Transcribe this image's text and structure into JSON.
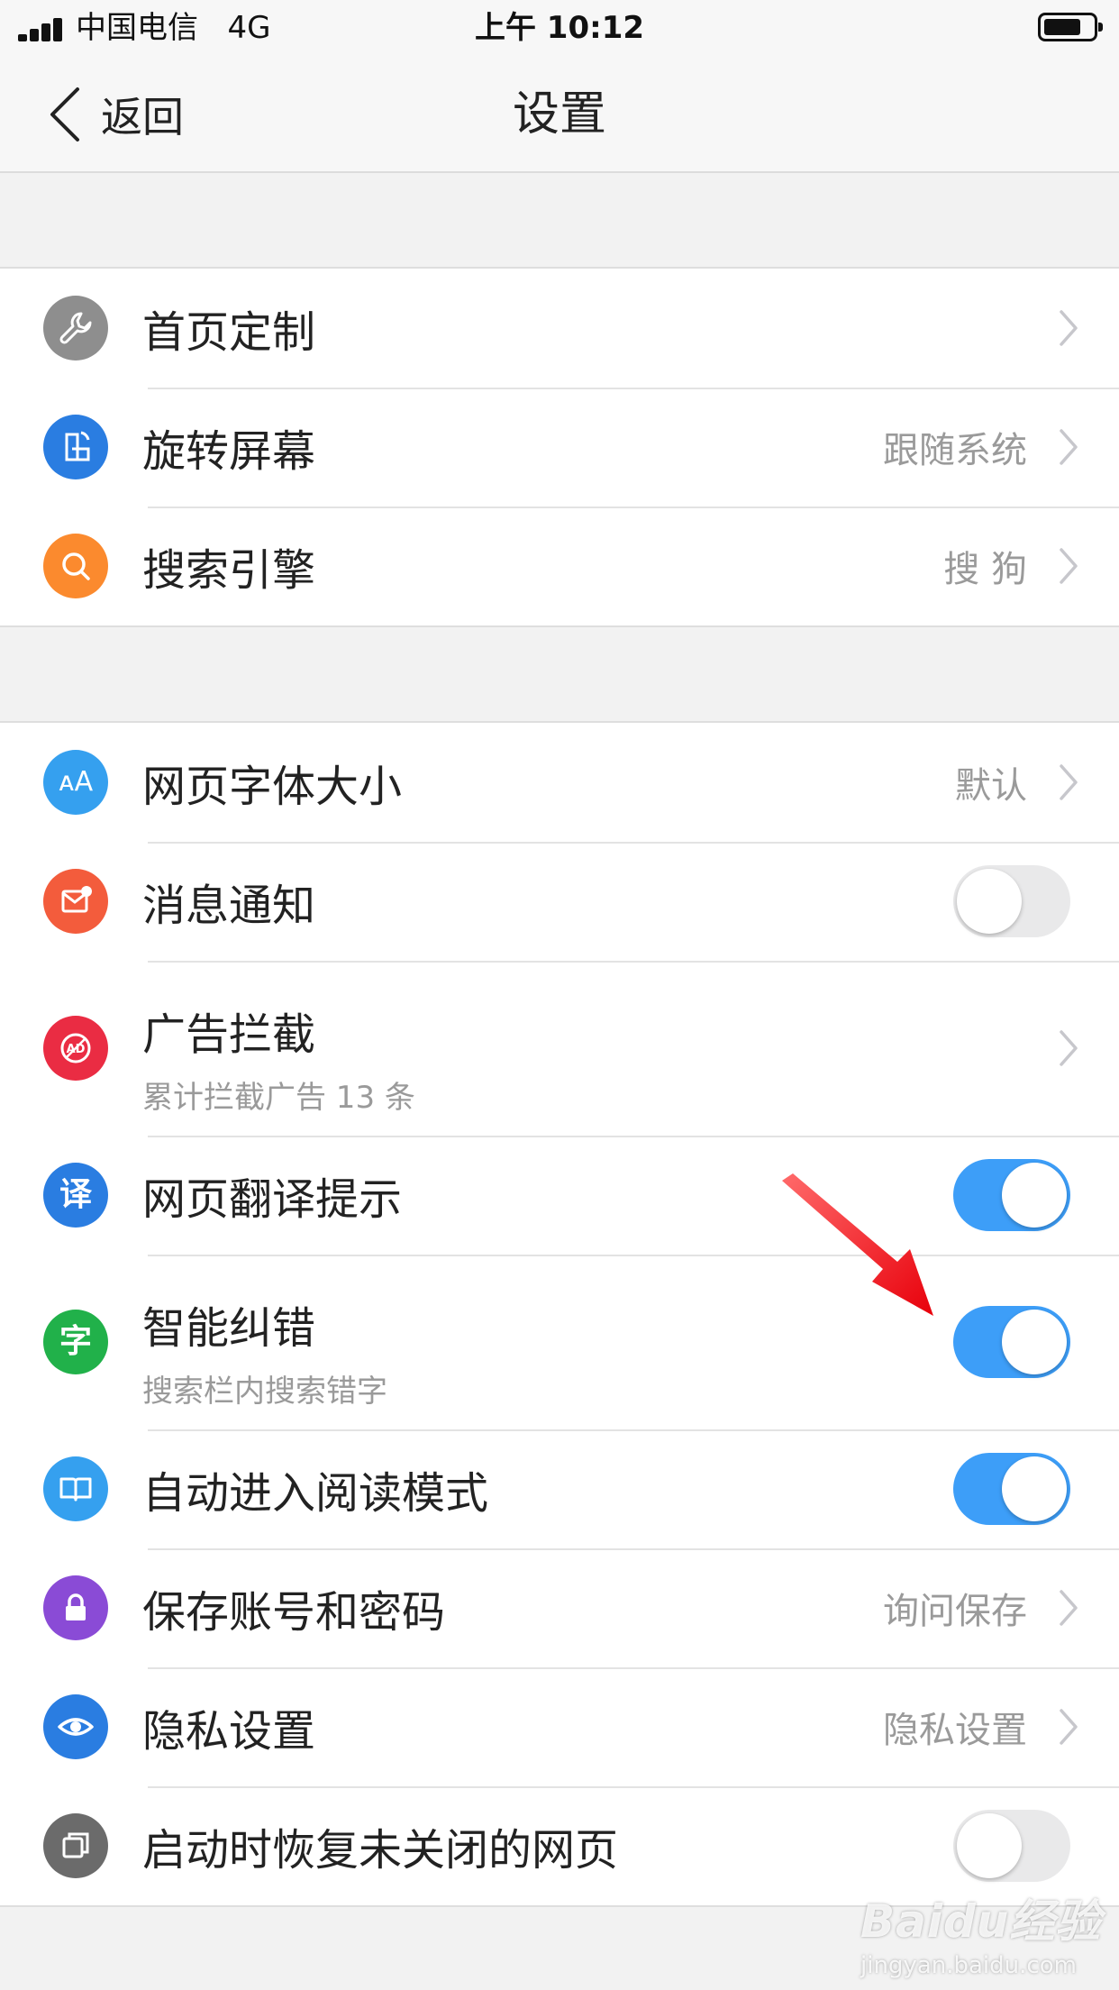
{
  "status_bar": {
    "carrier": "中国电信",
    "network": "4G",
    "time": "上午 10:12"
  },
  "nav": {
    "back_label": "返回",
    "title": "设置"
  },
  "groups": [
    {
      "items": [
        {
          "label": "首页定制",
          "value": "",
          "icon": "wrench-icon",
          "icon_color": "#8e8e8e"
        },
        {
          "label": "旋转屏幕",
          "value": "跟随系统",
          "icon": "rotate-screen-icon",
          "icon_color": "#2a7de1"
        },
        {
          "label": "搜索引擎",
          "value": "搜 狗",
          "icon": "search-icon",
          "icon_color": "#fb8a2e"
        }
      ]
    },
    {
      "items": [
        {
          "label": "网页字体大小",
          "value": "默认",
          "icon": "font-size-icon",
          "icon_glyph": "ᴀA",
          "icon_color": "#35a0ef"
        },
        {
          "label": "消息通知",
          "toggle": false,
          "icon": "message-icon",
          "icon_color": "#f35c3c"
        },
        {
          "label": "广告拦截",
          "sub": "累计拦截广告 13 条",
          "icon": "ad-block-icon",
          "icon_color": "#ea2c43"
        },
        {
          "label": "网页翻译提示",
          "toggle": true,
          "icon": "translate-icon",
          "icon_glyph": "译",
          "icon_color": "#2a7de1"
        },
        {
          "label": "智能纠错",
          "sub": "搜索栏内搜索错字",
          "toggle": true,
          "icon": "character-icon",
          "icon_glyph": "字",
          "icon_color": "#21b14a"
        },
        {
          "label": "自动进入阅读模式",
          "toggle": true,
          "icon": "book-icon",
          "icon_color": "#35a0ef"
        },
        {
          "label": "保存账号和密码",
          "value": "询问保存",
          "icon": "lock-icon",
          "icon_color": "#8a4bd6"
        },
        {
          "label": "隐私设置",
          "value": "隐私设置",
          "icon": "eye-icon",
          "icon_color": "#2a7de1"
        },
        {
          "label": "启动时恢复未关闭的网页",
          "toggle": false,
          "icon": "restore-pages-icon",
          "icon_color": "#6b6b6b"
        }
      ]
    }
  ],
  "colors": {
    "toggle_on": "#3d9ef8",
    "toggle_off": "#e9e9ea",
    "annotation_arrow": "#e8000b"
  },
  "watermark": {
    "brand": "Baidu经验",
    "site": "jingyan.baidu.com"
  }
}
